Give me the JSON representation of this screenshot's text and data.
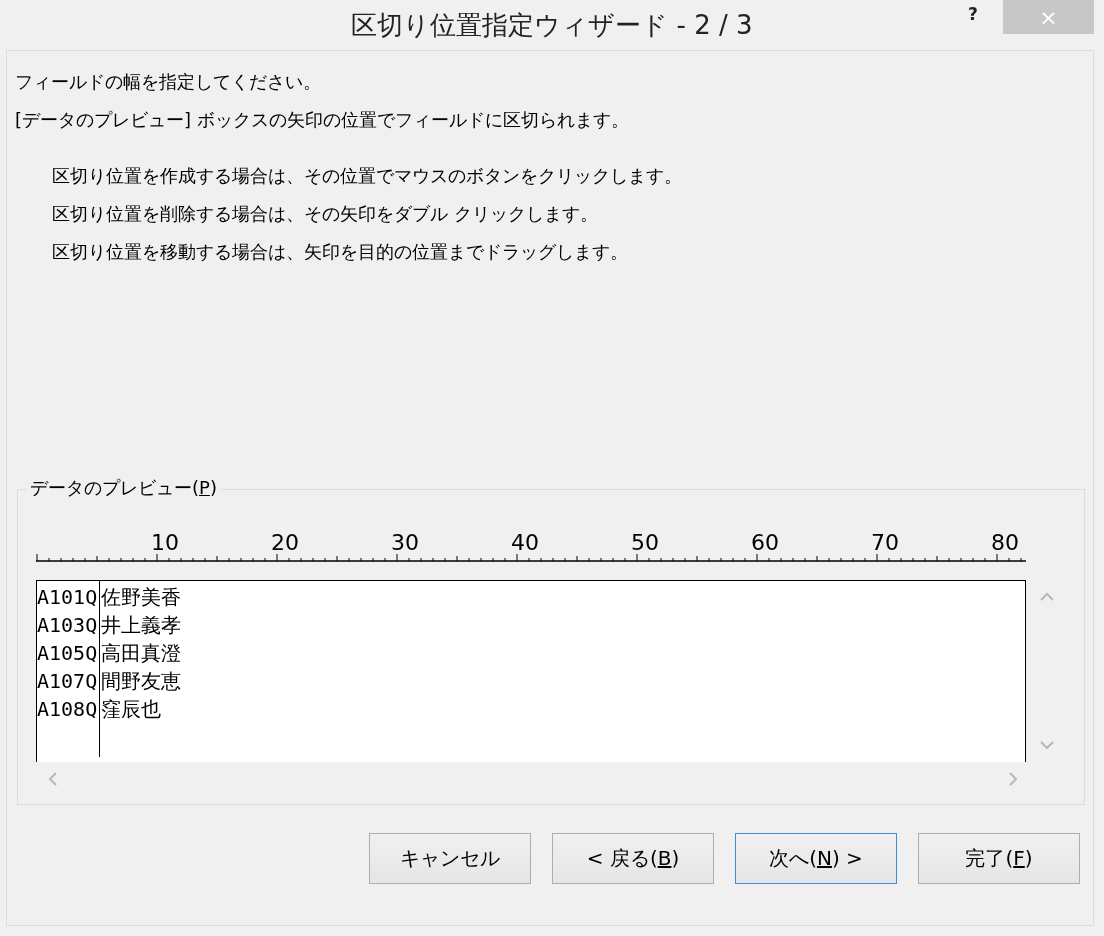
{
  "window": {
    "title": "区切り位置指定ウィザード - 2 / 3",
    "help": "?",
    "close": "×"
  },
  "instructions": [
    "フィールドの幅を指定してください。",
    "[データのプレビュー] ボックスの矢印の位置でフィールドに区切られます。"
  ],
  "hints": [
    "区切り位置を作成する場合は、その位置でマウスのボタンをクリックします。",
    "区切り位置を削除する場合は、その矢印をダブル クリックします。",
    "区切り位置を移動する場合は、矢印を目的の位置までドラッグします。"
  ],
  "preview": {
    "label_start": "データのプレビュー(",
    "access_key": "P",
    "label_end": ")",
    "ruler": [
      "10",
      "20",
      "30",
      "40",
      "50",
      "60",
      "70",
      "80"
    ],
    "rows": [
      [
        "A101Q",
        "佐野美香"
      ],
      [
        "A103Q",
        "井上義孝"
      ],
      [
        "A105Q",
        "高田真澄"
      ],
      [
        "A107Q",
        "間野友恵"
      ],
      [
        "A108Q",
        "窪辰也"
      ]
    ]
  },
  "buttons": [
    {
      "label_start": "キャンセル",
      "focused": false
    },
    {
      "label_start": "< 戻る(",
      "access_key": "B",
      "label_end": ")",
      "focused": false
    },
    {
      "label_start": "次へ(",
      "access_key": "N",
      "label_end": ") >",
      "focused": true
    },
    {
      "label_start": "完了(",
      "access_key": "F",
      "label_end": ")",
      "focused": false
    }
  ]
}
